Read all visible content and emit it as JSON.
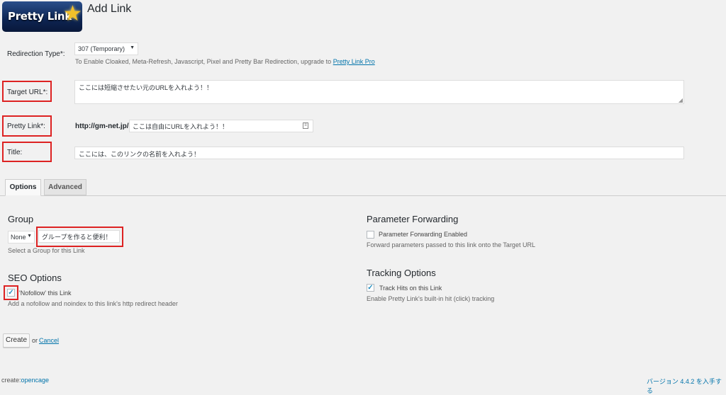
{
  "header": {
    "logo_text": "Pretty Link",
    "title": "Add Link"
  },
  "redirection": {
    "label": "Redirection Type*:",
    "selected": "307 (Temporary)",
    "note": "To Enable Cloaked, Meta-Refresh, Javascript, Pixel and Pretty Bar Redirection, upgrade to",
    "note_link": "Pretty Link Pro"
  },
  "target_url": {
    "label": "Target URL*:",
    "value": "ここには短縮させたい元のURLを入れよう！！"
  },
  "pretty_link": {
    "label": "Pretty Link*:",
    "prefix": "http://gm-net.jp/",
    "value": "ここは自由にURLを入れよう！！"
  },
  "title_field": {
    "label": "Title:",
    "value": "ここには、このリンクの名前を入れよう！"
  },
  "tabs": [
    {
      "label": "Options",
      "active": true
    },
    {
      "label": "Advanced",
      "active": false
    }
  ],
  "group": {
    "heading": "Group",
    "selected": "None",
    "new_group_value": "グループを作ると便利！",
    "desc": "Select a Group for this Link"
  },
  "seo": {
    "heading": "SEO Options",
    "nofollow_label": "'Nofollow' this Link",
    "nofollow_checked": true,
    "desc": "Add a nofollow and noindex to this link's http redirect header"
  },
  "parameter_forwarding": {
    "heading": "Parameter Forwarding",
    "checkbox_label": "Parameter Forwarding Enabled",
    "checked": false,
    "desc": "Forward parameters passed to this link onto the Target URL"
  },
  "tracking": {
    "heading": "Tracking Options",
    "checkbox_label": "Track Hits on this Link",
    "checked": true,
    "desc": "Enable Pretty Link's built-in hit (click) tracking"
  },
  "actions": {
    "create_label": "Create",
    "or_text": "or",
    "cancel_label": "Cancel"
  },
  "footer": {
    "credit_prefix": "create:",
    "credit_link": "opencage",
    "version_text": "バージョン 4.4.2 を入手する"
  },
  "colors": {
    "highlight": "#dd2222",
    "link": "#0073aa",
    "background": "#f1f1f1"
  },
  "icons": {
    "dropdown": "chevron-down-icon",
    "checkmark": "check-icon",
    "field_icon": "id-card-icon"
  }
}
